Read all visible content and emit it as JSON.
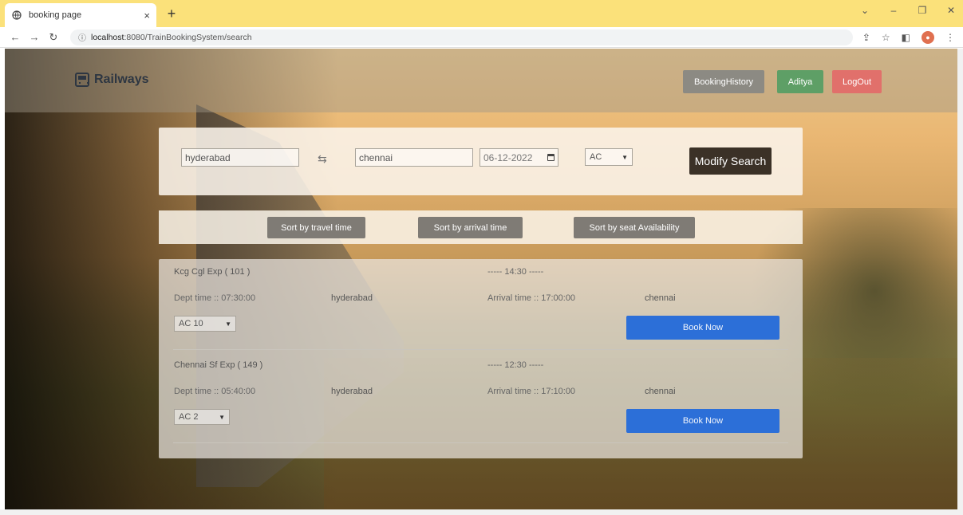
{
  "browser": {
    "tab_title": "booking page",
    "tab_close": "×",
    "new_tab": "+",
    "url_host": "localhost",
    "url_rest": ":8080/TrainBookingSystem/search",
    "window_controls": [
      "⌄",
      "–",
      "❐",
      "✕"
    ]
  },
  "navbar": {
    "brand": "Railways",
    "history_label": "BookingHistory",
    "user_label": "Aditya",
    "logout_label": "LogOut"
  },
  "search": {
    "from": "hyderabad",
    "to": "chennai",
    "date": "06-12-2022",
    "class": "AC",
    "modify_label": "Modify Search"
  },
  "sort": {
    "travel_time": "Sort by travel time",
    "arrival_time": "Sort by arrival time",
    "seat_availability": "Sort by seat Availability"
  },
  "trains": [
    {
      "name": "Kcg Cgl Exp ( 101 )",
      "duration": "----- 14:30 -----",
      "dept": "Dept time :: 07:30:00",
      "from": "hyderabad",
      "arrival": "Arrival time :: 17:00:00",
      "to": "chennai",
      "class": "AC 10",
      "book_label": "Book Now"
    },
    {
      "name": "Chennai Sf Exp ( 149 )",
      "duration": "----- 12:30 -----",
      "dept": "Dept time :: 05:40:00",
      "from": "hyderabad",
      "arrival": "Arrival time :: 17:10:00",
      "to": "chennai",
      "class": "AC 2",
      "book_label": "Book Now"
    }
  ],
  "colors": {
    "chrome": "#fbe17a",
    "book_button": "#2c6fd8",
    "modify_button": "#3b3127",
    "user_button": "#5e9f66",
    "logout_button": "#e1706b"
  }
}
